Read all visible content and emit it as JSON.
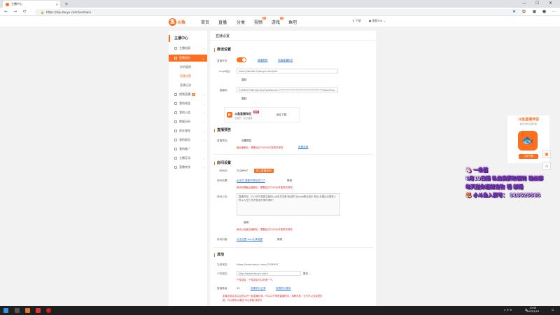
{
  "browser": {
    "tab_title": "主播中心",
    "url": "https://mp.douyu.com/live/main",
    "new_tab": "+",
    "minimize": "—",
    "maximize": "☐",
    "close": "✕"
  },
  "header": {
    "logo_text": "斗鱼",
    "logo_mark": "鱼",
    "nav": [
      {
        "label": "首页"
      },
      {
        "label": "直播"
      },
      {
        "label": "分类"
      },
      {
        "label": "视频",
        "badge": "新"
      },
      {
        "label": "游戏",
        "badge": "荐"
      },
      {
        "label": "鱼吧"
      }
    ],
    "download": "下载",
    "user": "墨影mo"
  },
  "sidebar": {
    "title": "主播中心",
    "items": [
      {
        "label": "主播档案",
        "chev": "›"
      },
      {
        "label": "直播相关",
        "chev": "⌄",
        "active": true
      },
      {
        "label": "你的管理",
        "sub": true
      },
      {
        "label": "直播设置",
        "sub": true,
        "active": true
      },
      {
        "label": "直播记录",
        "sub": true
      },
      {
        "label": "视频直播",
        "chev": "›",
        "hot": "新"
      },
      {
        "label": "我的收益",
        "chev": "›"
      },
      {
        "label": "我的公会",
        "chev": "›"
      },
      {
        "label": "数据分析",
        "chev": "›"
      },
      {
        "label": "商业变现",
        "chev": "›"
      },
      {
        "label": "我的报告",
        "chev": "›"
      },
      {
        "label": "我的推广",
        "chev": ""
      },
      {
        "label": "主播互动",
        "chev": "›"
      },
      {
        "label": "直播考核",
        "chev": "›"
      }
    ]
  },
  "main": {
    "title": "直播设置",
    "stream": {
      "section": "推流设置",
      "switch_label": "直播开关：",
      "switch_link1": "直播教程",
      "switch_link2": "电脑直播助手",
      "rtmp_label": "rtmp地址：",
      "rtmp_value": "rtmp://sendtc3.douyu.com/live",
      "copy1": "复制",
      "code_label": "直播码：",
      "code_value": "7426997rNmQsrVp2?wsSecret=***********************************&wsTime",
      "copy2": "复制",
      "promo_title": "斗鱼直播伴侣",
      "promo_tag": "推荐",
      "promo_sub": "完美的一站式直播",
      "promo_btn": "前往下载"
    },
    "preview": {
      "section": "直播预告",
      "label": "直播预告：",
      "value": "设置预告",
      "note": "最近编辑后：需要经过7000W才能再次修改",
      "link": "查看说明"
    },
    "room": {
      "section": "房间设置",
      "id_label": "房间ID：",
      "id_value": "7426997",
      "id_btn": "进入直播房间",
      "title_label": "房间标题：",
      "title_value": "出名方-墨影你现在的门了",
      "title_edit": "修改",
      "title_note": "房间标题最近编辑后：需要经过7000W才能再次修改",
      "notice_label": "房间公告：",
      "notice_text": "直播时间：13:30开  围观主播可以点击关注哦 粉丝群 @pubg职业选手 粉丝 全国比分赛事人 所以人在打 别开挂就行啊打得好！",
      "notice_edit": "修改",
      "notice_note": "房间公告最近编辑后：需要经过7000W才能再次修改",
      "cover_label": "房间封面：",
      "cover_link": "点击这里-mm大体验图",
      "cover_edit": "修改"
    },
    "other": {
      "section": "其他",
      "domain_label": "当前域名：",
      "domain_value": "https://www.douyu.com/7426997",
      "custom_label": "个性域名：",
      "custom_value": "http://www.douyu.com/",
      "custom_btn": "提交",
      "custom_note": "个性域名：个性域名可以申请一个。",
      "level_label": "直播等级：",
      "level_value": "12",
      "level_link1": "查看积分记录",
      "level_link2": "查看积分规则",
      "level_note1": "如果出现实名认证的以外一起直播记录，可以以不停更直播时间，请联系我，为方可以支持更多",
      "level_note2": "推，可以提供以便使  可以获取-按积分"
    }
  },
  "right_panel": {
    "title": "斗鱼直播伴侣",
    "subtitle": "超好用的直播利器",
    "btn": "立即下载"
  },
  "overlay": {
    "line1": "一条酱",
    "line2": "6月13日播 私信我获取福利",
    "line2_tail": "粉丝群",
    "line3": "每天送你迎新宠物",
    "line3_tail": "锤 新锤",
    "line4": "小斗鱼入群号：",
    "line4_num": "313525585"
  },
  "taskbar": {
    "time": "13:45",
    "date": "2022/2/18",
    "lang": "英",
    "tray": "∧ ⊙ ⟲"
  },
  "colors": {
    "accent": "#ff6d1f",
    "link": "#2a6ed8",
    "warn": "#e02f2f"
  }
}
